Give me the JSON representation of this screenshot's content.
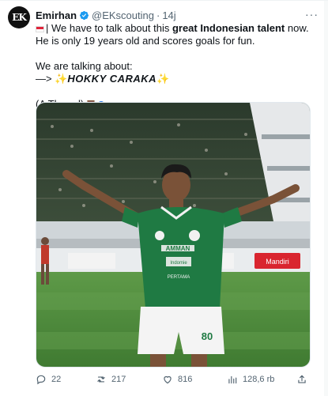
{
  "tweet": {
    "author_name": "Emirhan",
    "handle": "@EKscouting",
    "separator": "·",
    "time": "14j",
    "avatar_text": "EK",
    "more_label": "···",
    "line1_pre": "| We have to talk about this ",
    "line1_bold": "great Indonesian talent",
    "line1_post": " now. He is only 19 years old and scores goals for fun.",
    "line2": "We are talking about:",
    "line3_arrow": "—>",
    "line3_name": "HOKKY CARAKA",
    "line4": "(A Thread)",
    "flag_icon": "indonesia-flag-icon",
    "spark_icon": "sparkles-icon"
  },
  "media": {
    "jersey_number": "80",
    "sponsor": "AMMAN",
    "sponsor2": "Indomie",
    "sponsor3": "PERTAMA",
    "banner_text": "Mandiri"
  },
  "actions": {
    "replies": "22",
    "reposts": "217",
    "likes": "816",
    "views": "128,6 rb"
  },
  "colors": {
    "text": "#0f1419",
    "secondary": "#536471",
    "verified": "#1d9bf0",
    "pitch": "#4f8a3c",
    "jersey": "#1f7a43"
  }
}
